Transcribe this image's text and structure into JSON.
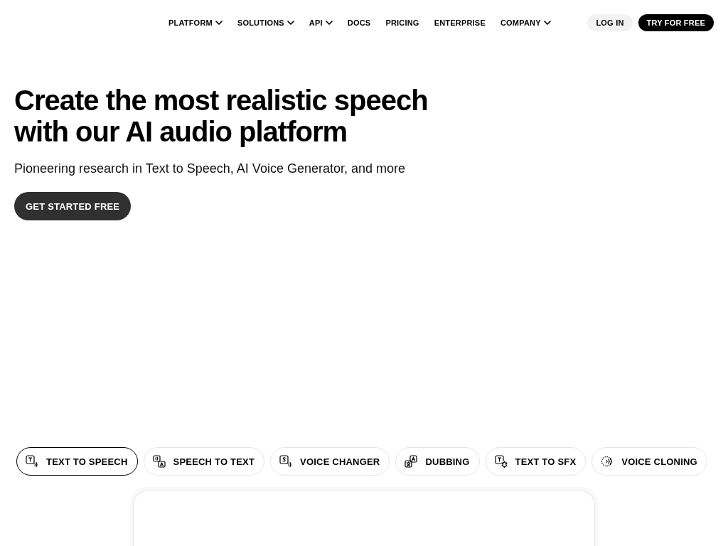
{
  "nav": {
    "items": [
      {
        "label": "PLATFORM",
        "kind": "menu"
      },
      {
        "label": "SOLUTIONS",
        "kind": "menu"
      },
      {
        "label": "API",
        "kind": "menu"
      },
      {
        "label": "DOCS",
        "kind": "link"
      },
      {
        "label": "PRICING",
        "kind": "link"
      },
      {
        "label": "ENTERPRISE",
        "kind": "link"
      },
      {
        "label": "COMPANY",
        "kind": "menu"
      }
    ],
    "actions": [
      {
        "label": "LOG IN",
        "kind": "secondary"
      },
      {
        "label": "TRY FOR FREE",
        "kind": "primary"
      }
    ]
  },
  "hero": {
    "title": "Create the most realistic speech with our AI audio platform",
    "subtitle": "Pioneering research in Text to Speech, AI Voice Generator, and more",
    "cta": "GET STARTED FREE"
  },
  "tabs": [
    {
      "label": "TEXT TO SPEECH",
      "selected": true
    },
    {
      "label": "SPEECH TO TEXT",
      "selected": false
    },
    {
      "label": "VOICE CHANGER",
      "selected": false
    },
    {
      "label": "DUBBING",
      "selected": false
    },
    {
      "label": "TEXT TO SFX",
      "selected": false
    },
    {
      "label": "VOICE CLONING",
      "selected": false
    }
  ]
}
